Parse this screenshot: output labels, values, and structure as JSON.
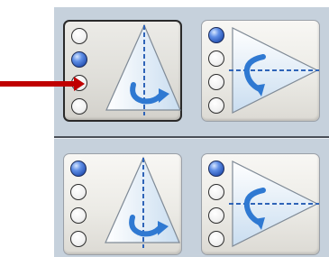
{
  "panel": {
    "background_color": "#c6d1dc",
    "buttons": [
      {
        "id": "top-left",
        "shape": "vertical-axis-triangle",
        "selected": true,
        "selected_radio": 2,
        "radio_count": 4
      },
      {
        "id": "top-right",
        "shape": "horizontal-axis-triangle",
        "selected": false,
        "selected_radio": 1,
        "radio_count": 4
      },
      {
        "id": "bottom-left",
        "shape": "vertical-axis-triangle",
        "selected": false,
        "selected_radio": 1,
        "radio_count": 4
      },
      {
        "id": "bottom-right",
        "shape": "horizontal-axis-triangle",
        "selected": false,
        "selected_radio": 1,
        "radio_count": 4
      }
    ]
  },
  "pointer": {
    "color": "#c00000",
    "icon": "right-arrow-icon"
  },
  "colors": {
    "radio_on": "#2a56b6",
    "shape_fill": "#ffffff",
    "shape_shade": "#c9ddf0",
    "axis_line": "#2f64b8",
    "rotation_arrow": "#2f79d2"
  }
}
